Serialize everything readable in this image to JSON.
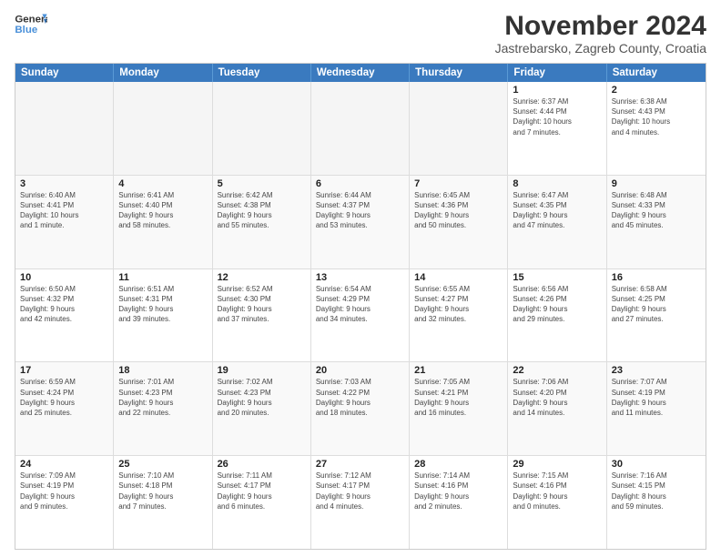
{
  "header": {
    "logo_line1": "General",
    "logo_line2": "Blue",
    "title": "November 2024",
    "subtitle": "Jastrebarsko, Zagreb County, Croatia"
  },
  "days_of_week": [
    "Sunday",
    "Monday",
    "Tuesday",
    "Wednesday",
    "Thursday",
    "Friday",
    "Saturday"
  ],
  "weeks": [
    [
      {
        "num": "",
        "info": "",
        "empty": true
      },
      {
        "num": "",
        "info": "",
        "empty": true
      },
      {
        "num": "",
        "info": "",
        "empty": true
      },
      {
        "num": "",
        "info": "",
        "empty": true
      },
      {
        "num": "",
        "info": "",
        "empty": true
      },
      {
        "num": "1",
        "info": "Sunrise: 6:37 AM\nSunset: 4:44 PM\nDaylight: 10 hours\nand 7 minutes."
      },
      {
        "num": "2",
        "info": "Sunrise: 6:38 AM\nSunset: 4:43 PM\nDaylight: 10 hours\nand 4 minutes."
      }
    ],
    [
      {
        "num": "3",
        "info": "Sunrise: 6:40 AM\nSunset: 4:41 PM\nDaylight: 10 hours\nand 1 minute."
      },
      {
        "num": "4",
        "info": "Sunrise: 6:41 AM\nSunset: 4:40 PM\nDaylight: 9 hours\nand 58 minutes."
      },
      {
        "num": "5",
        "info": "Sunrise: 6:42 AM\nSunset: 4:38 PM\nDaylight: 9 hours\nand 55 minutes."
      },
      {
        "num": "6",
        "info": "Sunrise: 6:44 AM\nSunset: 4:37 PM\nDaylight: 9 hours\nand 53 minutes."
      },
      {
        "num": "7",
        "info": "Sunrise: 6:45 AM\nSunset: 4:36 PM\nDaylight: 9 hours\nand 50 minutes."
      },
      {
        "num": "8",
        "info": "Sunrise: 6:47 AM\nSunset: 4:35 PM\nDaylight: 9 hours\nand 47 minutes."
      },
      {
        "num": "9",
        "info": "Sunrise: 6:48 AM\nSunset: 4:33 PM\nDaylight: 9 hours\nand 45 minutes."
      }
    ],
    [
      {
        "num": "10",
        "info": "Sunrise: 6:50 AM\nSunset: 4:32 PM\nDaylight: 9 hours\nand 42 minutes."
      },
      {
        "num": "11",
        "info": "Sunrise: 6:51 AM\nSunset: 4:31 PM\nDaylight: 9 hours\nand 39 minutes."
      },
      {
        "num": "12",
        "info": "Sunrise: 6:52 AM\nSunset: 4:30 PM\nDaylight: 9 hours\nand 37 minutes."
      },
      {
        "num": "13",
        "info": "Sunrise: 6:54 AM\nSunset: 4:29 PM\nDaylight: 9 hours\nand 34 minutes."
      },
      {
        "num": "14",
        "info": "Sunrise: 6:55 AM\nSunset: 4:27 PM\nDaylight: 9 hours\nand 32 minutes."
      },
      {
        "num": "15",
        "info": "Sunrise: 6:56 AM\nSunset: 4:26 PM\nDaylight: 9 hours\nand 29 minutes."
      },
      {
        "num": "16",
        "info": "Sunrise: 6:58 AM\nSunset: 4:25 PM\nDaylight: 9 hours\nand 27 minutes."
      }
    ],
    [
      {
        "num": "17",
        "info": "Sunrise: 6:59 AM\nSunset: 4:24 PM\nDaylight: 9 hours\nand 25 minutes."
      },
      {
        "num": "18",
        "info": "Sunrise: 7:01 AM\nSunset: 4:23 PM\nDaylight: 9 hours\nand 22 minutes."
      },
      {
        "num": "19",
        "info": "Sunrise: 7:02 AM\nSunset: 4:23 PM\nDaylight: 9 hours\nand 20 minutes."
      },
      {
        "num": "20",
        "info": "Sunrise: 7:03 AM\nSunset: 4:22 PM\nDaylight: 9 hours\nand 18 minutes."
      },
      {
        "num": "21",
        "info": "Sunrise: 7:05 AM\nSunset: 4:21 PM\nDaylight: 9 hours\nand 16 minutes."
      },
      {
        "num": "22",
        "info": "Sunrise: 7:06 AM\nSunset: 4:20 PM\nDaylight: 9 hours\nand 14 minutes."
      },
      {
        "num": "23",
        "info": "Sunrise: 7:07 AM\nSunset: 4:19 PM\nDaylight: 9 hours\nand 11 minutes."
      }
    ],
    [
      {
        "num": "24",
        "info": "Sunrise: 7:09 AM\nSunset: 4:19 PM\nDaylight: 9 hours\nand 9 minutes."
      },
      {
        "num": "25",
        "info": "Sunrise: 7:10 AM\nSunset: 4:18 PM\nDaylight: 9 hours\nand 7 minutes."
      },
      {
        "num": "26",
        "info": "Sunrise: 7:11 AM\nSunset: 4:17 PM\nDaylight: 9 hours\nand 6 minutes."
      },
      {
        "num": "27",
        "info": "Sunrise: 7:12 AM\nSunset: 4:17 PM\nDaylight: 9 hours\nand 4 minutes."
      },
      {
        "num": "28",
        "info": "Sunrise: 7:14 AM\nSunset: 4:16 PM\nDaylight: 9 hours\nand 2 minutes."
      },
      {
        "num": "29",
        "info": "Sunrise: 7:15 AM\nSunset: 4:16 PM\nDaylight: 9 hours\nand 0 minutes."
      },
      {
        "num": "30",
        "info": "Sunrise: 7:16 AM\nSunset: 4:15 PM\nDaylight: 8 hours\nand 59 minutes."
      }
    ]
  ]
}
